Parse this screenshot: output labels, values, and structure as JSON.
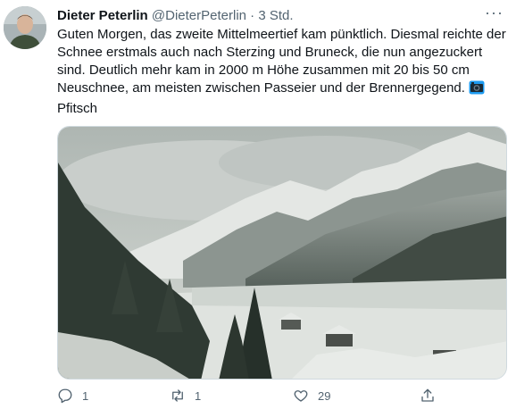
{
  "tweet": {
    "author_name": "Dieter Peterlin",
    "handle": "@DieterPeterlin",
    "separator": "·",
    "time": "3 Std.",
    "more_label": "···",
    "text": "Guten Morgen, das zweite Mittelmeertief kam pünktlich. Diesmal reichte der Schnee erstmals auch nach Sterzing und Bruneck, die nun angezuckert sind. Deutlich mehr kam in 2000 m Höhe zusammen mit 20 bis 50 cm Neuschnee, am meisten zwischen Passeier und der Brennergegend.",
    "text_end": "Pfitsch",
    "inline_icon": "camera-icon"
  },
  "actions": {
    "reply_count": "1",
    "retweet_count": "1",
    "like_count": "29"
  },
  "icons": [
    "reply-icon",
    "retweet-icon",
    "like-icon",
    "share-icon",
    "camera-icon"
  ],
  "colors": {
    "text": "#0f1419",
    "secondary": "#536471",
    "camera_blue": "#1d9bf0"
  }
}
